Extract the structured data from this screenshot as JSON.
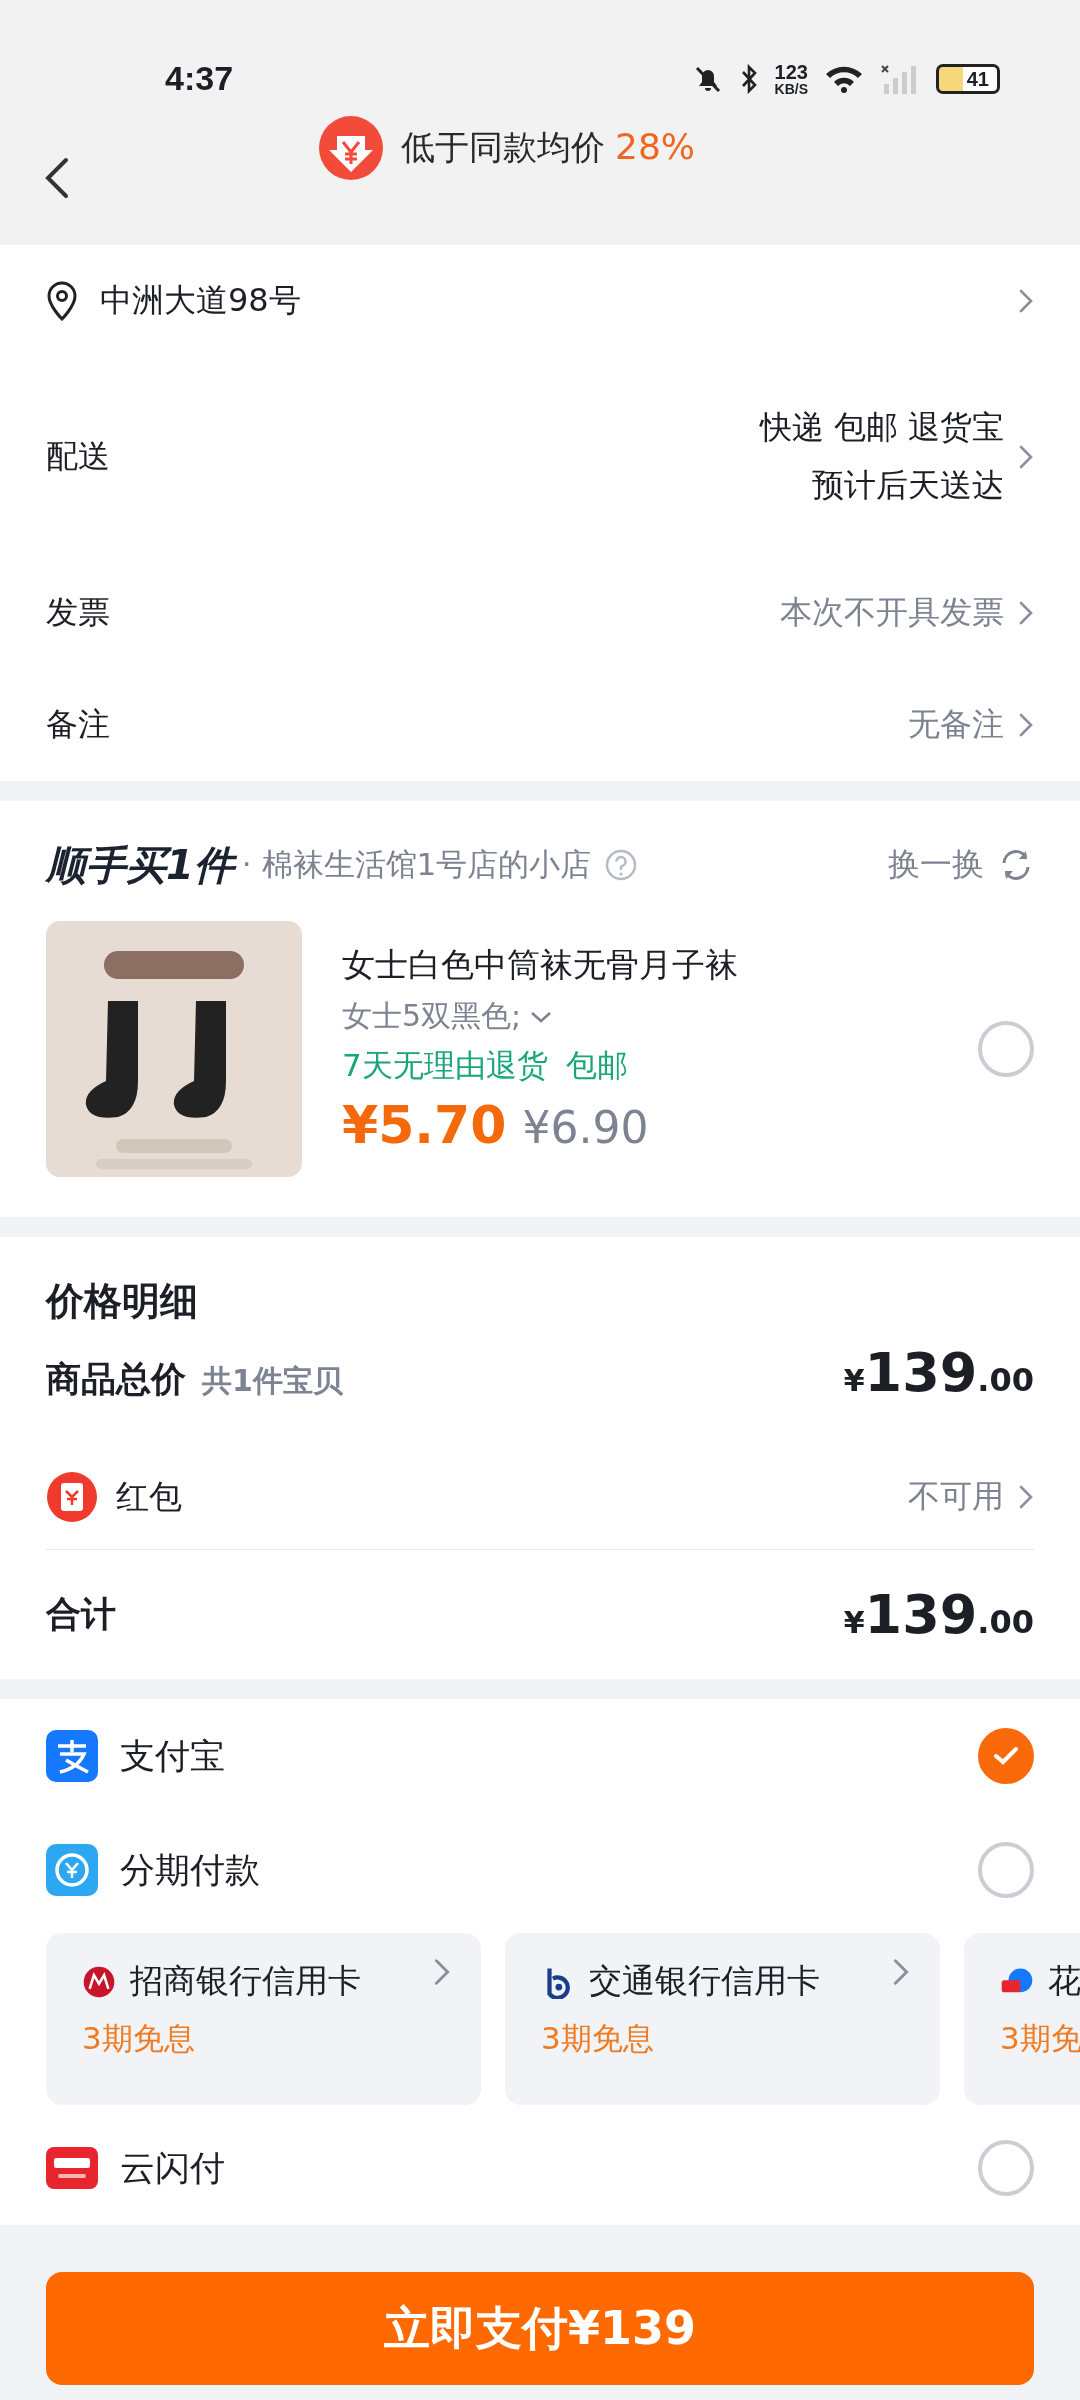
{
  "status_bar": {
    "time": "4:37",
    "speed_value": "123",
    "speed_unit": "KB/S",
    "battery": "41"
  },
  "header": {
    "title": "低于同款均价",
    "highlight": "28%"
  },
  "address": {
    "text": "中洲大道98号"
  },
  "order_rows": [
    {
      "label": "配送",
      "kind": "strong",
      "values": [
        "快递 包邮 退货宝",
        "预计后天送达"
      ]
    },
    {
      "label": "发票",
      "kind": "muted",
      "values": [
        "本次不开具发票"
      ]
    },
    {
      "label": "备注",
      "kind": "muted",
      "values": [
        "无备注"
      ]
    }
  ],
  "addon": {
    "brand": "顺手买1件",
    "store": "· 棉袜生活馆1号店的小店",
    "swap": "换一换",
    "product": {
      "kind": "picture",
      "title": "女士白色中筒袜无骨月子袜",
      "spec": "女士5双黑色;",
      "tags": [
        "7天无理由退货",
        "包邮"
      ],
      "price": "¥5.70",
      "original_price": "¥6.90",
      "selected": false
    }
  },
  "price_detail": {
    "title": "价格明细",
    "rows": [
      {
        "kind": "amount",
        "label": "商品总价",
        "note": "共1件宝贝",
        "amount": {
          "currency": "¥",
          "integer": "139",
          "decimals": ".00"
        }
      },
      {
        "kind": "link",
        "label": "红包",
        "value": "不可用"
      },
      {
        "kind": "total",
        "label": "合计",
        "amount": {
          "currency": "¥",
          "integer": "139",
          "decimals": ".00"
        }
      }
    ]
  },
  "payments": [
    {
      "kind": "alipay",
      "name": "支付宝",
      "selected": true
    },
    {
      "kind": "installment",
      "name": "分期付款",
      "selected": false,
      "cards": [
        {
          "kind": "cmb",
          "bank": "招商银行信用卡",
          "offer": "3期免息"
        },
        {
          "kind": "bocom",
          "bank": "交通银行信用卡",
          "offer": "3期免息"
        },
        {
          "kind": "huabei",
          "bank": "花",
          "offer": "3期免"
        }
      ]
    },
    {
      "kind": "unionpay",
      "name": "云闪付",
      "selected": false
    }
  ],
  "pay_button": {
    "label": "立即支付¥139"
  }
}
